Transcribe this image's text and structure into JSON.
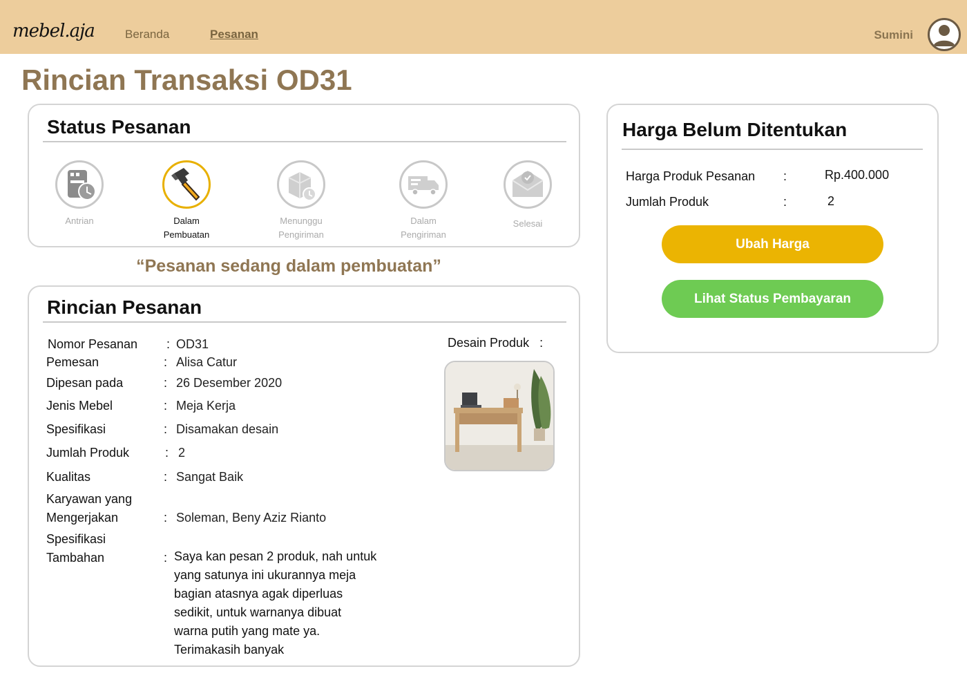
{
  "nav": {
    "logo": "mebel.aja",
    "links": [
      {
        "label": "Beranda",
        "active": false
      },
      {
        "label": "Pesanan",
        "active": true
      }
    ],
    "user_name": "Sumini",
    "avatar_icon": "user-avatar-icon"
  },
  "page_title": "Rincian Transaksi OD31",
  "status_card": {
    "title": "Status Pesanan",
    "steps": [
      {
        "label_line1": "Antrian",
        "label_line2": "",
        "icon": "queue-clock-icon",
        "active": false
      },
      {
        "label_line1": "Dalam",
        "label_line2": "Pembuatan",
        "icon": "hammer-icon",
        "active": true
      },
      {
        "label_line1": "Menunggu",
        "label_line2": "Pengiriman",
        "icon": "package-clock-icon",
        "active": false
      },
      {
        "label_line1": "Dalam",
        "label_line2": "Pengiriman",
        "icon": "delivery-truck-icon",
        "active": false
      },
      {
        "label_line1": "Selesai",
        "label_line2": "",
        "icon": "envelope-check-icon",
        "active": false
      }
    ],
    "active_color": "#E8B000",
    "inactive_color": "#C8C8C8"
  },
  "status_message": "“Pesanan sedang dalam pembuatan”",
  "detail_card": {
    "title": "Rincian Pesanan",
    "rows": [
      {
        "label": "Nomor Pesanan",
        "value": "OD31"
      },
      {
        "label": "Pemesan",
        "value": "Alisa Catur"
      },
      {
        "label": "Dipesan pada",
        "value": "26 Desember 2020"
      },
      {
        "label": "Jenis Mebel",
        "value": "Meja Kerja"
      },
      {
        "label": "Spesifikasi",
        "value": "Disamakan desain"
      },
      {
        "label": "Jumlah Produk",
        "value": "2"
      },
      {
        "label": "Kualitas",
        "value": "Sangat Baik"
      },
      {
        "label_line1": "Karyawan yang",
        "label_line2": "Mengerjakan",
        "value": "Soleman, Beny Aziz Rianto"
      },
      {
        "label_line1": "Spesifikasi",
        "label_line2": "Tambahan"
      }
    ],
    "notes_lines": [
      "Saya kan pesan 2 produk, nah untuk",
      "yang satunya ini ukurannya meja",
      "bagian atasnya agak diperluas",
      "sedikit, untuk warnanya dibuat",
      "warna putih yang mate ya.",
      "Terimakasih banyak"
    ],
    "desain_label": "Desain Produk",
    "desain_image": "office-desk-photo"
  },
  "price_card": {
    "title": "Harga Belum Ditentukan",
    "rows": [
      {
        "label": "Harga Produk Pesanan",
        "value": "Rp.400.000"
      },
      {
        "label": "Jumlah Produk",
        "value": "2"
      }
    ],
    "buttons": {
      "change_price": "Ubah Harga",
      "payment_status": "Lihat Status Pembayaran"
    },
    "colors": {
      "primary_button": "#EBB402",
      "secondary_button": "#6ECB53"
    }
  },
  "colors": {
    "navbar": "#EDCD9C",
    "title_brown": "#8F7653"
  },
  "separator": ":"
}
